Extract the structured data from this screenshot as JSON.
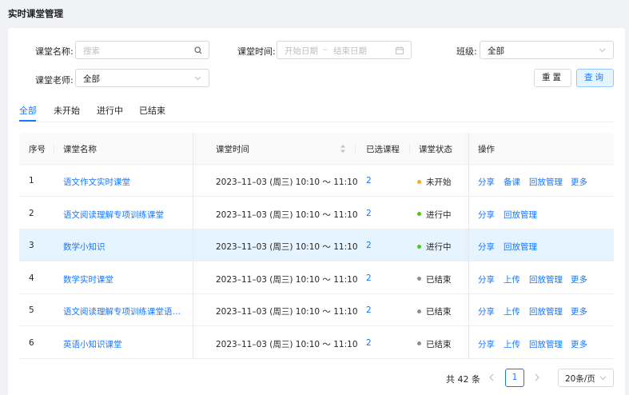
{
  "page": {
    "title": "实时课堂管理"
  },
  "filters": {
    "name_label": "课堂名称:",
    "name_placeholder": "搜索",
    "time_label": "课堂时间:",
    "time_start_placeholder": "开始日期",
    "time_separator": "–",
    "time_end_placeholder": "结束日期",
    "class_label": "班级:",
    "class_value": "全部",
    "teacher_label": "课堂老师:",
    "teacher_value": "全部",
    "reset_label": "重置",
    "query_label": "查询"
  },
  "tabs": [
    "全部",
    "未开始",
    "进行中",
    "已结束"
  ],
  "active_tab": "全部",
  "table": {
    "headers": {
      "index": "序号",
      "name": "课堂名称",
      "time": "课堂时间",
      "courses": "已选课程",
      "status": "课堂状态",
      "actions": "操作"
    },
    "rows": [
      {
        "index": "1",
        "name": "语文作文实时课堂",
        "time": "2023–11–03 (周三) 10:10 ～ 11:10",
        "courses": "2",
        "status": "未开始",
        "status_color": "#faad14",
        "actions": [
          "分享",
          "备课",
          "回放管理",
          "更多"
        ]
      },
      {
        "index": "2",
        "name": "语文阅读理解专项训练课堂",
        "time": "2023–11–03 (周三) 10:10 ～ 11:10",
        "courses": "2",
        "status": "进行中",
        "status_color": "#52c41a",
        "actions": [
          "分享",
          "回放管理"
        ]
      },
      {
        "index": "3",
        "name": "数学小知识",
        "time": "2023–11–03 (周三) 10:10 ～ 11:10",
        "courses": "2",
        "status": "进行中",
        "status_color": "#52c41a",
        "actions": [
          "分享",
          "回放管理"
        ],
        "highlighted": true
      },
      {
        "index": "4",
        "name": "数学实时课堂",
        "time": "2023–11–03 (周三) 10:10 ～ 11:10",
        "courses": "2",
        "status": "已结束",
        "status_color": "#8c8c8c",
        "actions": [
          "分享",
          "上传",
          "回放管理",
          "更多"
        ]
      },
      {
        "index": "5",
        "name": "语文阅读理解专项训练课堂语…",
        "time": "2023–11–03 (周三) 10:10 ～ 11:10",
        "courses": "2",
        "status": "已结束",
        "status_color": "#8c8c8c",
        "actions": [
          "分享",
          "上传",
          "回放管理",
          "更多"
        ]
      },
      {
        "index": "6",
        "name": "英语小知识课堂",
        "time": "2023–11–03 (周三) 10:10 ～ 11:10",
        "courses": "2",
        "status": "已结束",
        "status_color": "#8c8c8c",
        "actions": [
          "分享",
          "上传",
          "回放管理",
          "更多"
        ]
      }
    ]
  },
  "pagination": {
    "total_text": "共 42 条",
    "current_page": "1",
    "page_size": "20条/页"
  },
  "colors": {
    "primary": "#1677ff",
    "primary_light": "#e6f4ff",
    "border": "#d9d9d9"
  }
}
